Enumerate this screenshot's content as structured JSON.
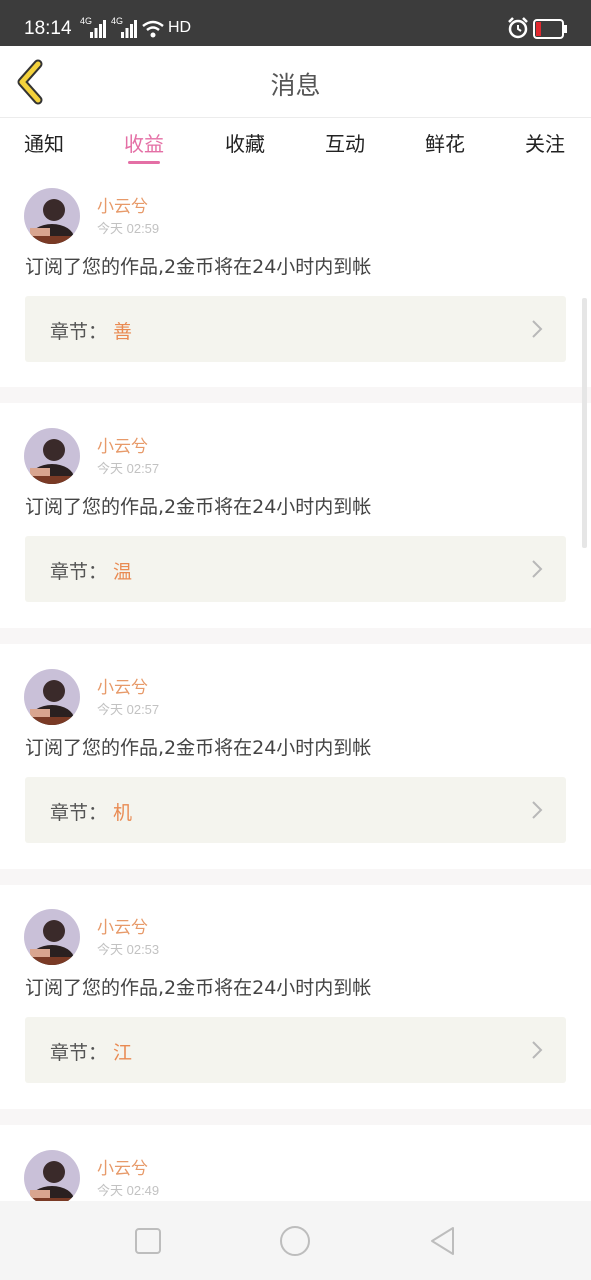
{
  "status": {
    "time": "18:14",
    "net1": "4G",
    "net2": "4G",
    "hd": "HD"
  },
  "header": {
    "title": "消息"
  },
  "tabs": [
    {
      "label": "通知",
      "active": false
    },
    {
      "label": "收益",
      "active": true
    },
    {
      "label": "收藏",
      "active": false
    },
    {
      "label": "互动",
      "active": false
    },
    {
      "label": "鲜花",
      "active": false
    },
    {
      "label": "关注",
      "active": false
    }
  ],
  "messages": [
    {
      "user": "小云兮",
      "time": "今天 02:59",
      "text": "订阅了您的作品,2金币将在24小时内到帐",
      "chapter_label": "章节：",
      "chapter": "善"
    },
    {
      "user": "小云兮",
      "time": "今天 02:57",
      "text": "订阅了您的作品,2金币将在24小时内到帐",
      "chapter_label": "章节：",
      "chapter": "温"
    },
    {
      "user": "小云兮",
      "time": "今天 02:57",
      "text": "订阅了您的作品,2金币将在24小时内到帐",
      "chapter_label": "章节：",
      "chapter": "机"
    },
    {
      "user": "小云兮",
      "time": "今天 02:53",
      "text": "订阅了您的作品,2金币将在24小时内到帐",
      "chapter_label": "章节：",
      "chapter": "江"
    },
    {
      "user": "小云兮",
      "time": "今天 02:49"
    }
  ],
  "colors": {
    "accent": "#e46fa5",
    "username": "#e79a6a",
    "chapter": "#e98a52",
    "statusbar": "#3c3c3c"
  }
}
